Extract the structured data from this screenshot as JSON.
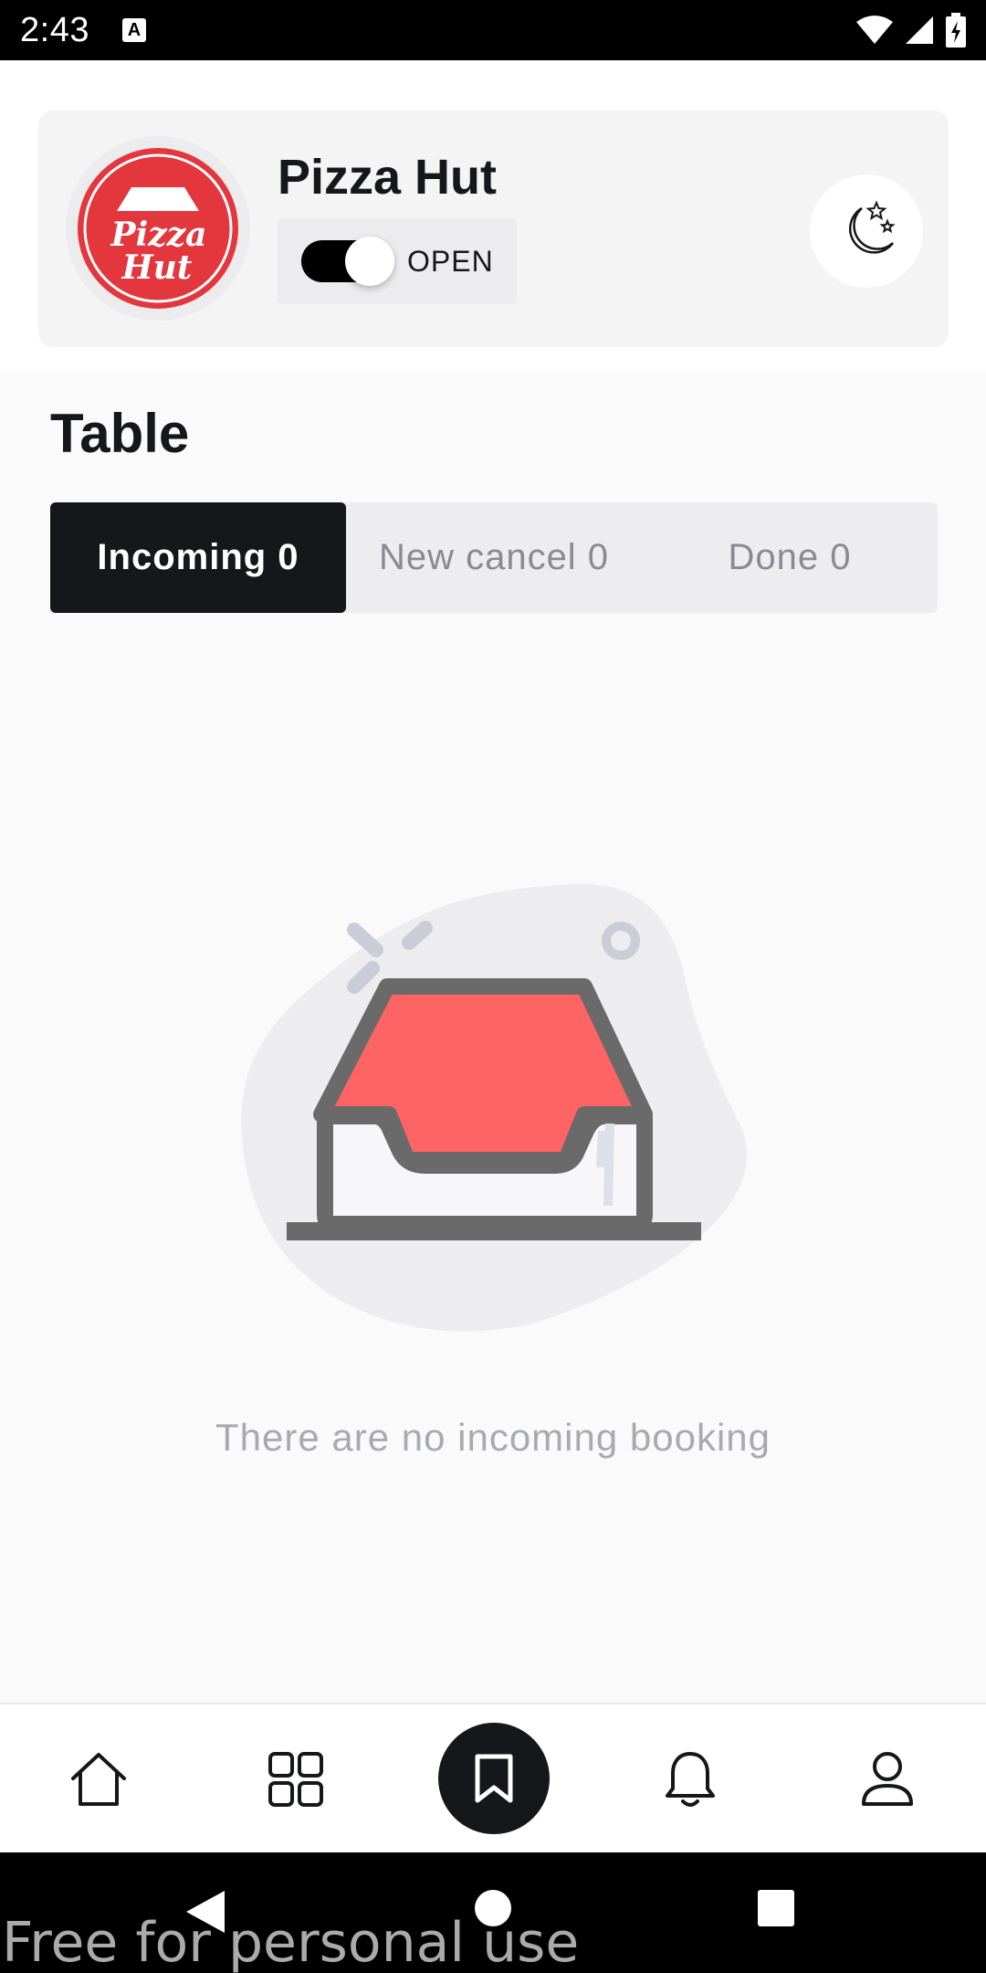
{
  "status_bar": {
    "time": "2:43",
    "notification_icon": "a-badge-icon",
    "notification_glyph": "A",
    "icons": [
      "wifi-icon",
      "signal-icon",
      "battery-icon"
    ]
  },
  "header": {
    "store_name": "Pizza Hut",
    "logo_text_line1": "Pizza",
    "logo_text_line2": "Hut",
    "toggle_label": "OPEN",
    "toggle_on": true,
    "night_mode_icon": "moon-stars-icon"
  },
  "page": {
    "title": "Table"
  },
  "tabs": [
    {
      "label": "Incoming 0",
      "active": true
    },
    {
      "label": "New cancel 0",
      "active": false
    },
    {
      "label": "Done 0",
      "active": false
    }
  ],
  "empty_state": {
    "icon": "empty-inbox-icon",
    "message": "There are no incoming booking"
  },
  "bottom_nav": {
    "items": [
      "home-icon",
      "grid-icon",
      "bookmark-icon",
      "bell-icon",
      "profile-icon"
    ],
    "active": "bookmark-icon"
  },
  "system_nav": [
    "back-icon",
    "home-circle-icon",
    "recents-icon"
  ],
  "watermark": "Free for personal use",
  "colors": {
    "brand_red": "#e3373d",
    "accent_dark": "#16171a",
    "illustration_red": "#ff6464"
  }
}
